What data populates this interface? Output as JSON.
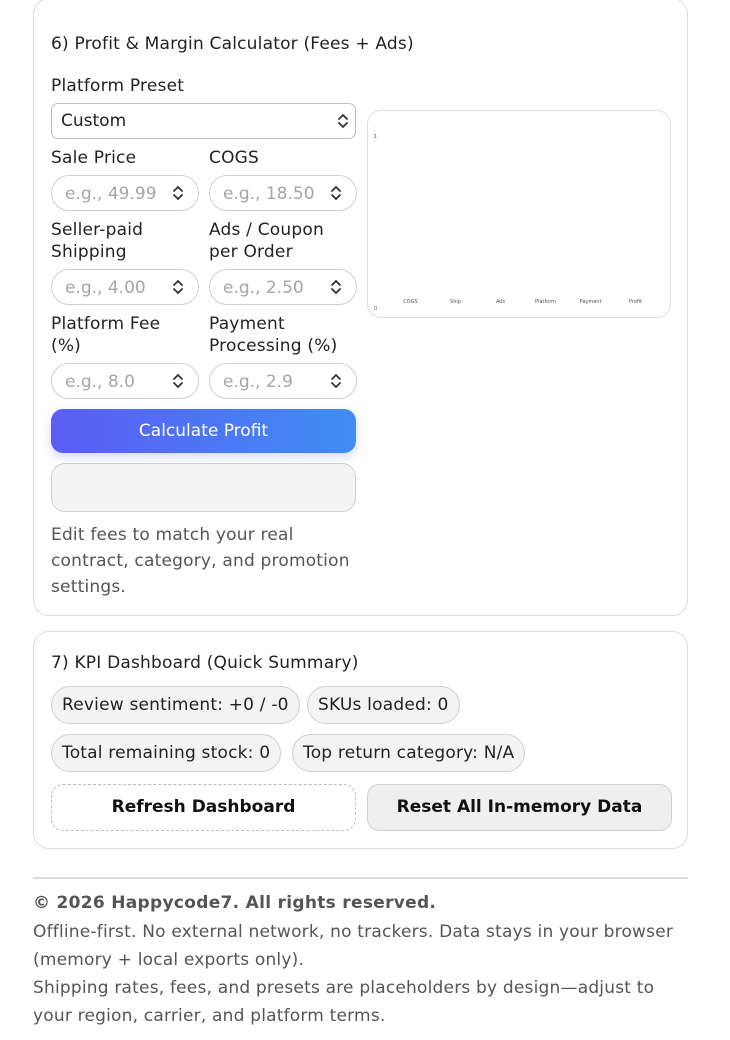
{
  "profit_calc": {
    "title": "6) Profit & Margin Calculator (Fees + Ads)",
    "preset_label": "Platform Preset",
    "preset_value": "Custom",
    "sale_price_label": "Sale Price",
    "sale_price_placeholder": "e.g., 49.99",
    "cogs_label": "COGS",
    "cogs_placeholder": "e.g., 18.50",
    "shipping_label_1": "Seller-paid",
    "shipping_label_2": "Shipping",
    "shipping_placeholder": "e.g., 4.00",
    "ads_label_1": "Ads / Coupon",
    "ads_label_2": "per Order",
    "ads_placeholder": "e.g., 2.50",
    "platform_fee_label_1": "Platform Fee",
    "platform_fee_label_2": "(%)",
    "platform_fee_placeholder": "e.g., 8.0",
    "payment_label_1": "Payment",
    "payment_label_2": "Processing (%)",
    "payment_placeholder": "e.g., 2.9",
    "calculate_label": "Calculate Profit",
    "note_1": "Edit fees to match your real",
    "note_2": "contract, category, and promotion",
    "note_3": "settings."
  },
  "chart_data": {
    "type": "bar",
    "categories": [
      "COGS",
      "Ship",
      "Ads",
      "Platform",
      "Payment",
      "Profit"
    ],
    "values": [
      0,
      0,
      0,
      0,
      0,
      0
    ],
    "ylim": [
      0,
      1
    ],
    "yticks": [
      "0",
      "1"
    ]
  },
  "kpi": {
    "title": "7) KPI Dashboard (Quick Summary)",
    "sentiment": "Review sentiment: +0 / -0",
    "skus": "SKUs loaded: 0",
    "stock": "Total remaining stock: 0",
    "return_category": "Top return category: N/A",
    "refresh_label": "Refresh Dashboard",
    "reset_label": "Reset All In-memory Data"
  },
  "footer": {
    "copyright": "© 2026 Happycode7. All rights reserved.",
    "line1": "Offline-first. No external network, no trackers. Data stays in your browser",
    "line2": "(memory + local exports only).",
    "line3": "Shipping rates, fees, and presets are placeholders by design—adjust to",
    "line4": "your region, carrier, and platform terms."
  }
}
